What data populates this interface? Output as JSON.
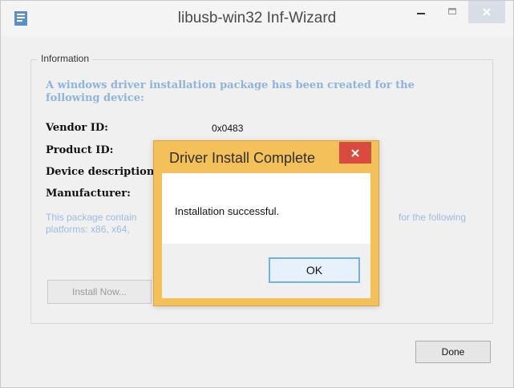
{
  "window": {
    "title": "libusb-win32 Inf-Wizard",
    "icon": "usb-app-icon",
    "controls": {
      "minimize": "minimize-icon",
      "maximize": "maximize-icon",
      "close": "close-icon"
    }
  },
  "info_group": {
    "legend": "Information",
    "intro": "A windows driver installation package has been created for the following device:",
    "fields": [
      {
        "label": "Vendor ID:",
        "value": "0x0483"
      },
      {
        "label": "Product ID:",
        "value": ""
      },
      {
        "label": "Device description",
        "value": ""
      },
      {
        "label": "Manufacturer:",
        "value": ""
      }
    ],
    "platform_note_left": "This package contain",
    "platform_note_left_line2": "platforms: x86, x64,",
    "platform_note_right": "for the following",
    "install_button": "Install Now..."
  },
  "footer": {
    "done_button": "Done"
  },
  "dialog": {
    "title": "Driver Install Complete",
    "message": "Installation successful.",
    "ok_button": "OK",
    "close_icon": "close-icon"
  },
  "colors": {
    "dialog_frame": "#f4c05a",
    "dialog_close": "#d94b3f",
    "intro_text": "#8db3df",
    "ok_border": "#6fb2ec"
  }
}
